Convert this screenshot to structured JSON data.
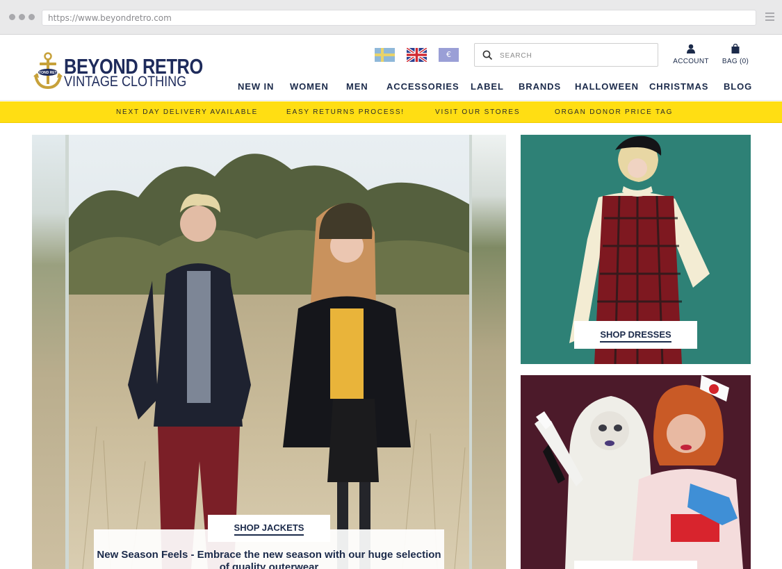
{
  "browser": {
    "url": "https://www.beyondretro.com"
  },
  "header": {
    "logo_line1": "BEYOND RETRO",
    "logo_line2": "VINTAGE CLOTHING",
    "logo_badge_text": "BEYOND RETRO",
    "flags": [
      {
        "name": "sweden",
        "label": ""
      },
      {
        "name": "united-kingdom",
        "label": ""
      },
      {
        "name": "euro",
        "label": "€"
      }
    ],
    "search_placeholder": "SEARCH",
    "account_label": "ACCOUNT",
    "bag_label": "BAG (0)"
  },
  "nav": {
    "items": [
      "NEW IN",
      "WOMEN",
      "MEN",
      "ACCESSORIES",
      "LABEL",
      "BRANDS",
      "HALLOWEEN",
      "CHRISTMAS",
      "BLOG"
    ]
  },
  "promo": {
    "items": [
      "NEXT DAY DELIVERY AVAILABLE",
      "EASY RETURNS PROCESS!",
      "VISIT OUR STORES",
      "ORGAN DONOR PRICE TAG"
    ]
  },
  "hero": {
    "cta_label": "SHOP JACKETS",
    "caption": "New Season Feels - Embrace the new season with our huge selection of quality outerwear"
  },
  "tiles": {
    "dresses_label": "SHOP DRESSES"
  },
  "colors": {
    "navy": "#1b2a4a",
    "promo_yellow": "#ffde13",
    "teal": "#2e8176",
    "maroon": "#4c1a2a"
  }
}
